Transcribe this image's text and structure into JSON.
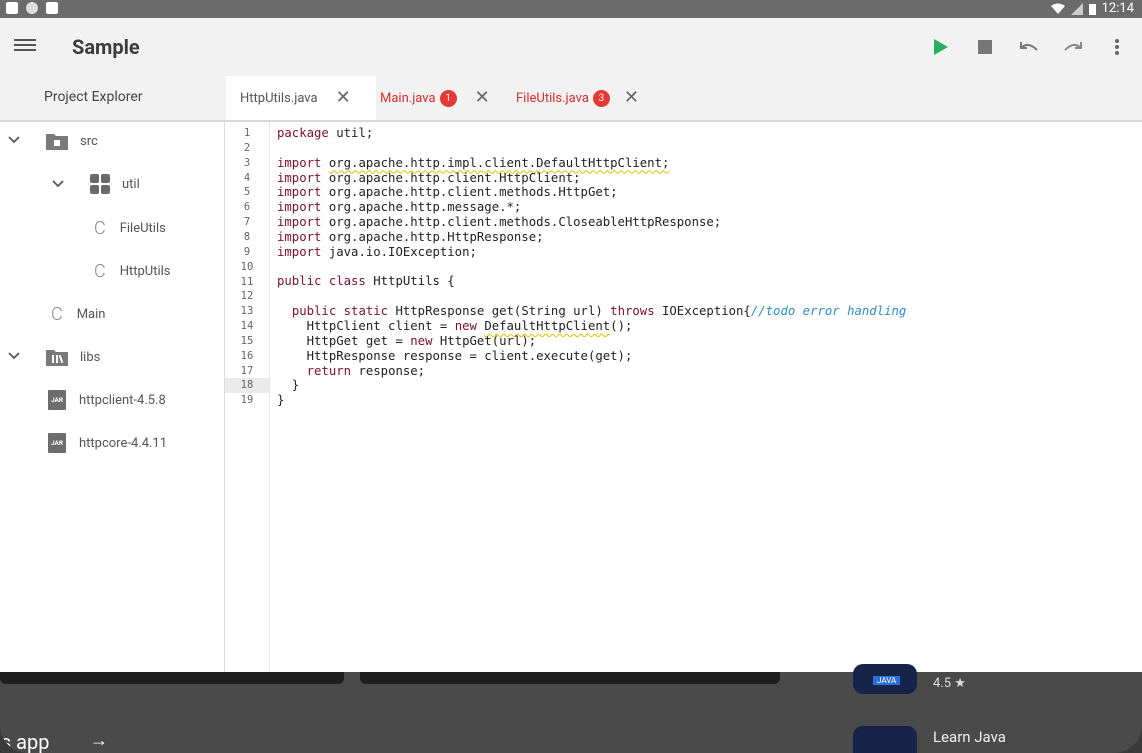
{
  "statusbar": {
    "time": "12:14"
  },
  "app": {
    "title": "Sample",
    "toolbar": {
      "run": "play-icon",
      "stop": "stop-icon",
      "undo": "undo-icon",
      "redo": "redo-icon",
      "more": "more-vert-icon"
    },
    "explorer_label": "Project Explorer",
    "tabs": [
      {
        "label": "HttpUtils.java",
        "active": true,
        "badge": ""
      },
      {
        "label": "Main.java",
        "active": false,
        "badge": "1"
      },
      {
        "label": "FileUtils.java",
        "active": false,
        "badge": "3"
      }
    ],
    "tree": [
      {
        "label": "src"
      },
      {
        "label": "util"
      },
      {
        "label": "FileUtils"
      },
      {
        "label": "HttpUtils"
      },
      {
        "label": "Main"
      },
      {
        "label": "libs"
      },
      {
        "label": "httpclient-4.5.8"
      },
      {
        "label": "httpcore-4.4.11"
      }
    ],
    "jar_badge": "JAR",
    "class_glyph": "C",
    "line_numbers": [
      "1",
      "2",
      "3",
      "4",
      "5",
      "6",
      "7",
      "8",
      "9",
      "10",
      "11",
      "12",
      "13",
      "14",
      "15",
      "16",
      "17",
      "18",
      "19"
    ],
    "current_line": 18
  },
  "background": {
    "rating": "4.5 ★",
    "app_name": "Learn Java",
    "heading_fragment": "is app",
    "arrow": "→",
    "icon_label": "JAVA"
  },
  "colors": {
    "accent_run": "#27ae60",
    "error": "#d32f2f",
    "keyword": "#7b1035",
    "comment": "#2f8ec8"
  }
}
